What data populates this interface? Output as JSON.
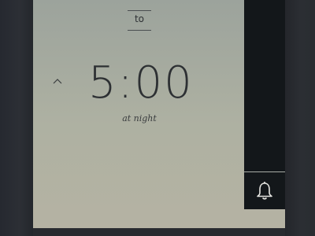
{
  "alarm": {
    "range_label": "to",
    "time": "5:00",
    "period": "at night"
  },
  "icons": {
    "increment": "chevron-up-icon",
    "alarm": "bell-icon"
  },
  "colors": {
    "screen_top": "#9ca39c",
    "screen_bottom": "#b5b2a3",
    "panel": "#13171a",
    "text": "#2d3033"
  }
}
